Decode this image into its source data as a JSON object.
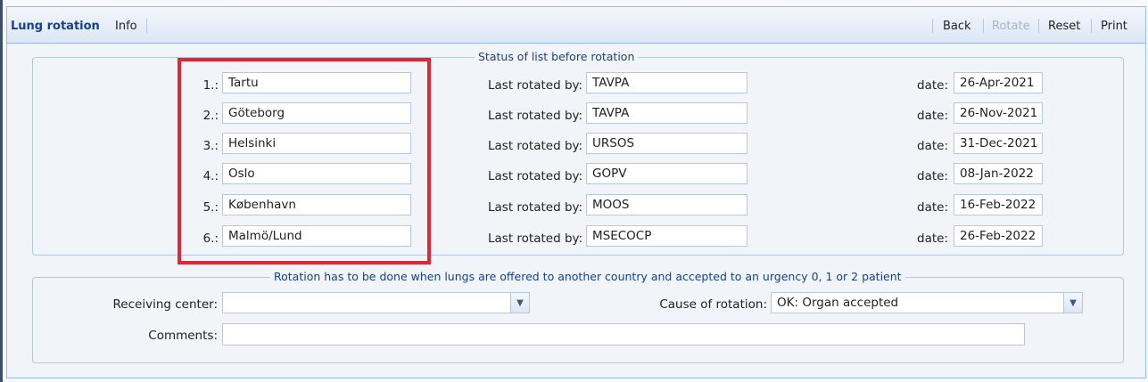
{
  "toolbar": {
    "tabs": [
      "Lung rotation",
      "Info"
    ],
    "buttons": {
      "back": "Back",
      "rotate": "Rotate",
      "reset": "Reset",
      "print": "Print"
    }
  },
  "status": {
    "legend": "Status of list before rotation",
    "last_rotated_label": "Last rotated by:",
    "date_label": "date:",
    "rows": [
      {
        "num": "1.:",
        "center": "Tartu",
        "by": "TAVPA",
        "date": "26-Apr-2021"
      },
      {
        "num": "2.:",
        "center": "Göteborg",
        "by": "TAVPA",
        "date": "26-Nov-2021"
      },
      {
        "num": "3.:",
        "center": "Helsinki",
        "by": "URSOS",
        "date": "31-Dec-2021"
      },
      {
        "num": "4.:",
        "center": "Oslo",
        "by": "GOPV",
        "date": "08-Jan-2022"
      },
      {
        "num": "5.:",
        "center": "København",
        "by": "MOOS",
        "date": "16-Feb-2022"
      },
      {
        "num": "6.:",
        "center": "Malmö/Lund",
        "by": "MSECOCP",
        "date": "26-Feb-2022"
      }
    ]
  },
  "rotation": {
    "legend": "Rotation has to be done when lungs are offered to another country and accepted to an urgency 0, 1 or 2 patient",
    "receiving_center_label": "Receiving center:",
    "receiving_center_value": "",
    "cause_label": "Cause of rotation:",
    "cause_value": "OK: Organ accepted",
    "comments_label": "Comments:",
    "comments_value": ""
  },
  "colors": {
    "highlight": "#e32631",
    "accent": "#15428b"
  }
}
